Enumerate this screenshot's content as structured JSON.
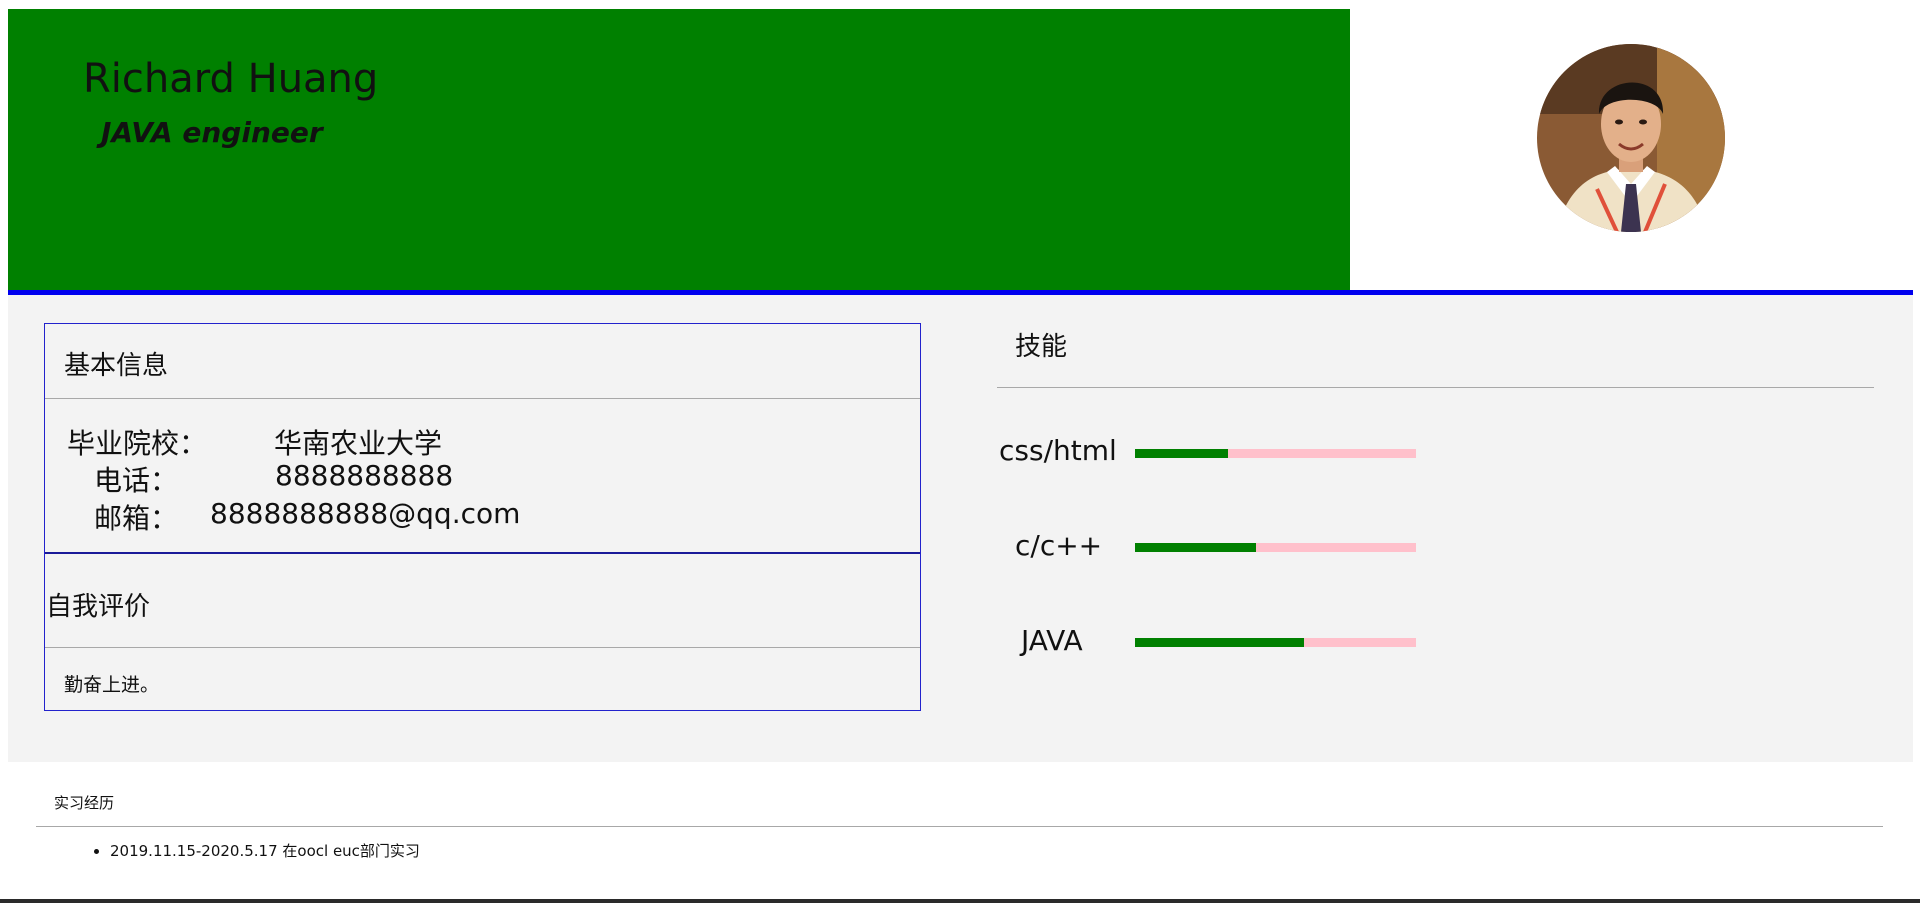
{
  "header": {
    "name": "Richard Huang",
    "job_title": "JAVA engineer",
    "banner_color": "#008000",
    "divider_color": "#0000ee"
  },
  "avatar": {
    "icon": "profile-photo"
  },
  "basic_info": {
    "title": "基本信息",
    "rows": [
      {
        "label": "毕业院校：",
        "value": "华南农业大学"
      },
      {
        "label": "电话：",
        "value": "8888888888"
      },
      {
        "label": "邮箱：",
        "value": "8888888888@qq.com"
      }
    ]
  },
  "self_eval": {
    "title": "自我评价",
    "text": "勤奋上进。"
  },
  "skills": {
    "title": "技能",
    "track_color": "#ffc0cb",
    "fill_color": "#008000",
    "items": [
      {
        "name": "css/html",
        "level": 0.33
      },
      {
        "name": "c/c++",
        "level": 0.43
      },
      {
        "name": "JAVA",
        "level": 0.6
      }
    ]
  },
  "internship": {
    "title": "实习经历",
    "items": [
      "2019.11.15-2020.5.17 在oocl euc部门实习"
    ]
  }
}
